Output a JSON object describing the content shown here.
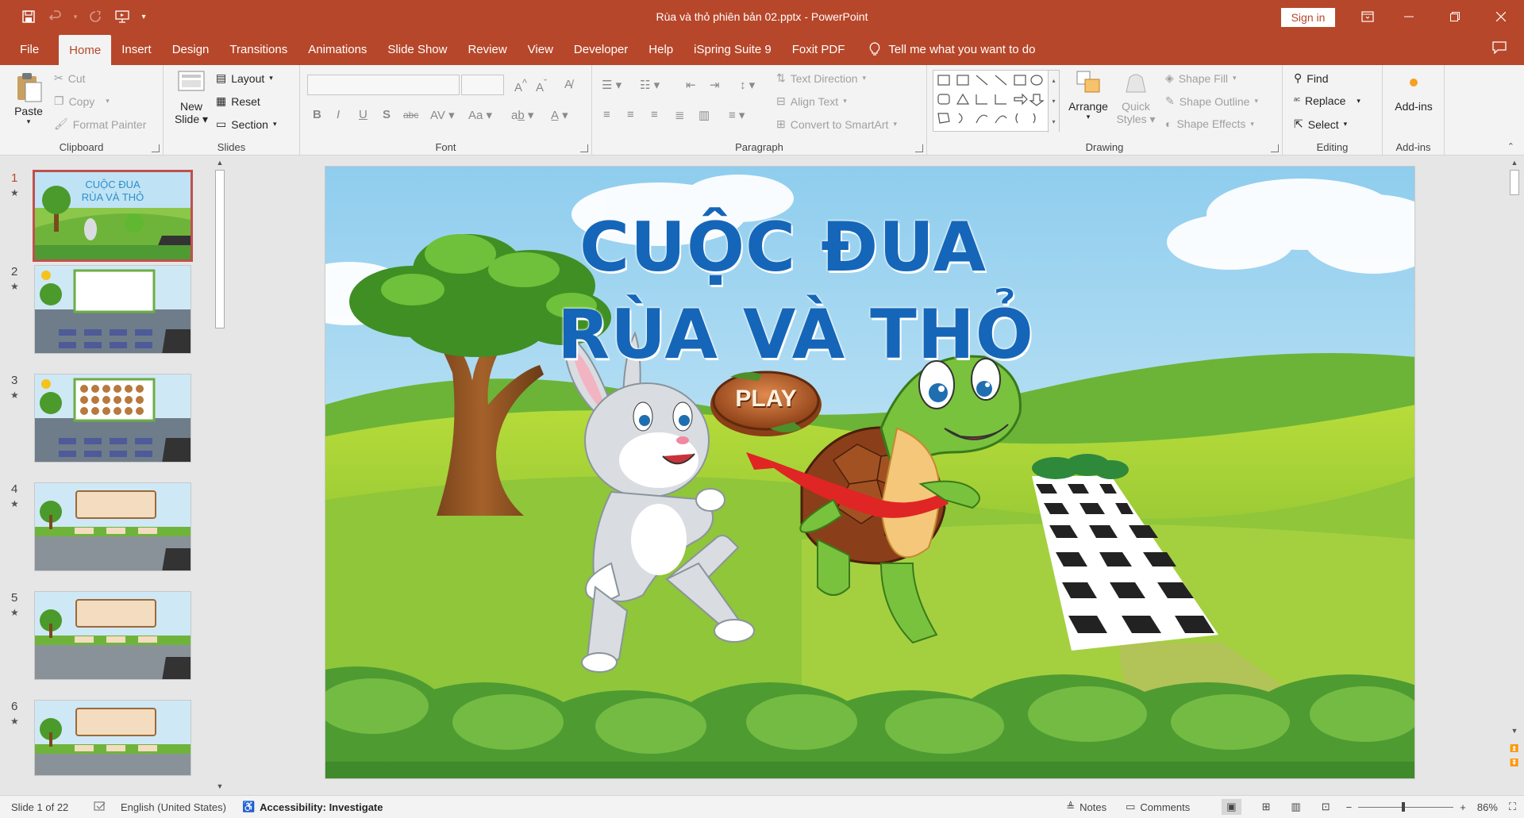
{
  "window": {
    "title": "Rùa và thỏ phiên bản 02.pptx  -  PowerPoint",
    "sign_in": "Sign in"
  },
  "tabs": [
    "File",
    "Home",
    "Insert",
    "Design",
    "Transitions",
    "Animations",
    "Slide Show",
    "Review",
    "View",
    "Developer",
    "Help",
    "iSpring Suite 9",
    "Foxit PDF"
  ],
  "active_tab": "Home",
  "tell_me": "Tell me what you want to do",
  "ribbon": {
    "clipboard": {
      "label": "Clipboard",
      "paste": "Paste",
      "cut": "Cut",
      "copy": "Copy",
      "format_painter": "Format Painter"
    },
    "slides": {
      "label": "Slides",
      "new_slide_line1": "New",
      "new_slide_line2": "Slide",
      "layout": "Layout",
      "reset": "Reset",
      "section": "Section"
    },
    "font": {
      "label": "Font"
    },
    "paragraph": {
      "label": "Paragraph",
      "text_direction": "Text Direction",
      "align_text": "Align Text",
      "convert_smartart": "Convert to SmartArt"
    },
    "drawing": {
      "label": "Drawing",
      "arrange": "Arrange",
      "quick_styles_line1": "Quick",
      "quick_styles_line2": "Styles",
      "shape_fill": "Shape Fill",
      "shape_outline": "Shape Outline",
      "shape_effects": "Shape Effects"
    },
    "editing": {
      "label": "Editing",
      "find": "Find",
      "replace": "Replace",
      "select": "Select"
    },
    "addins": {
      "label": "Add-ins",
      "addins_btn": "Add-ins"
    }
  },
  "thumbnails": [
    {
      "num": "1",
      "title_line1": "CUỘC ĐUA",
      "title_line2": "RÙA VÀ THỎ"
    },
    {
      "num": "2"
    },
    {
      "num": "3"
    },
    {
      "num": "4"
    },
    {
      "num": "5"
    },
    {
      "num": "6"
    }
  ],
  "slide": {
    "title_line1": "CUỘC ĐUA",
    "title_line2": "RÙA VÀ THỎ",
    "play_button": "PLAY"
  },
  "status": {
    "slide_indicator": "Slide 1 of 22",
    "language": "English (United States)",
    "accessibility": "Accessibility: Investigate",
    "notes": "Notes",
    "comments": "Comments",
    "zoom": "86%"
  }
}
